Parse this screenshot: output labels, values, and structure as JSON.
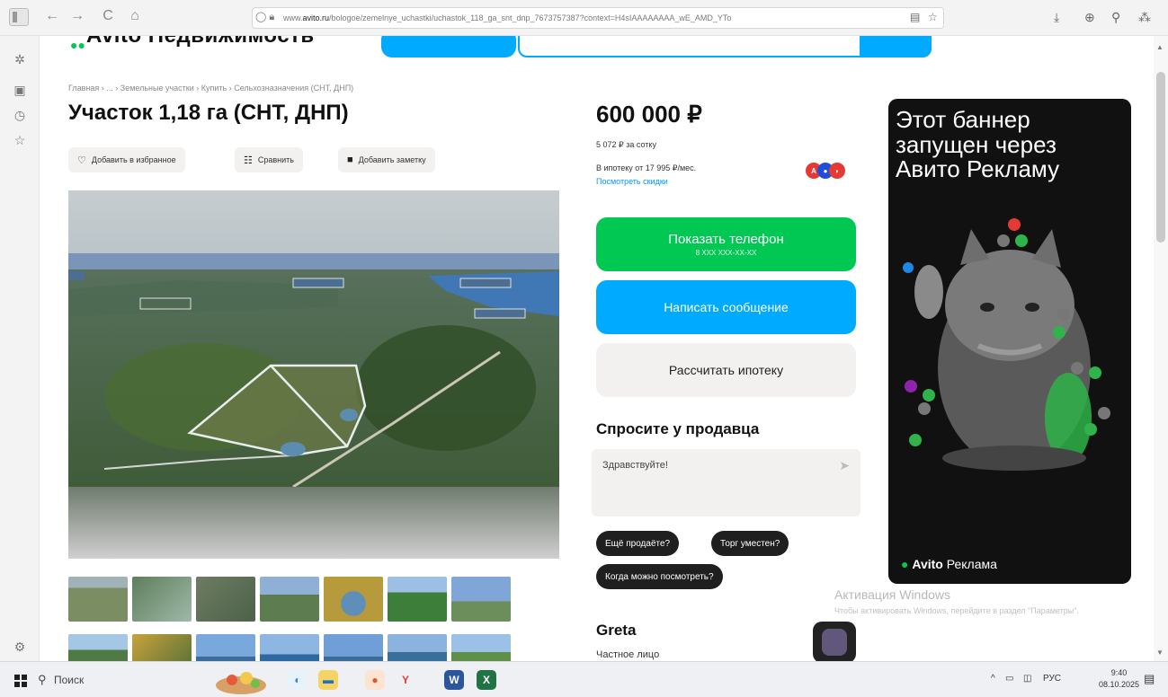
{
  "browser": {
    "url_prefix": "www.",
    "url_domain": "avito.ru",
    "url_rest": "/bologoe/zemelnye_uchastki/uchastok_118_ga_snt_dnp_7673757387?context=H4sIAAAAAAAA_wE_AMD_YTo",
    "nav": {
      "back": "←",
      "forward": "→",
      "reload": "C",
      "home": "⌂"
    }
  },
  "header": {
    "logo_text": "Avito Недвижимость"
  },
  "breadcrumb": "Главная › ... › Земельные участки › Купить › Сельхозназначения (СНТ, ДНП)",
  "listing": {
    "title": "Участок 1,18 га (СНТ, ДНП)",
    "actions": {
      "favorite": "Добавить в избранное",
      "compare": "Сравнить",
      "note": "Добавить заметку"
    }
  },
  "price": {
    "value": "600 000 ₽",
    "per_sotka": "5 072 ₽ за сотку",
    "mortgage": "В ипотеку от 17 995 ₽/мес.",
    "mortgage_link": "Посмотреть скидки"
  },
  "buttons": {
    "show_phone": "Показать телефон",
    "phone_masked": "8 XXX XXX-XX-XX",
    "write_message": "Написать сообщение",
    "calc_mortgage": "Рассчитать ипотеку"
  },
  "ask": {
    "title": "Спросите у продавца",
    "message": "Здравствуйте!",
    "chips": [
      "Ещё продаёте?",
      "Торг уместен?",
      "Когда можно посмотреть?"
    ]
  },
  "seller": {
    "name": "Greta",
    "type": "Частное лицо"
  },
  "banner": {
    "text": "Этот баннер запущен через Авито Рекламу",
    "brand_bold": "Avito",
    "brand_rest": "Реклама"
  },
  "windows_activation": {
    "title": "Активация Windows",
    "subtitle": "Чтобы активировать Windows, перейдите в раздел \"Параметры\"."
  },
  "taskbar": {
    "search": "Поиск",
    "lang": "РУС",
    "time": "9:40",
    "date": "08.10.2025"
  },
  "colors": {
    "green": "#00c853",
    "blue": "#00aaff",
    "gray_btn": "#f2f1f0",
    "chip": "#1f1f1f"
  }
}
